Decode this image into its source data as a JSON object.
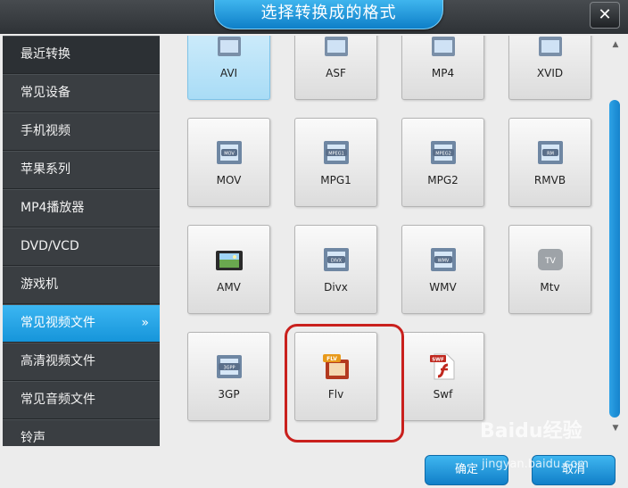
{
  "dialog": {
    "title": "选择转换成的格式",
    "close_label": "✕"
  },
  "sidebar": {
    "items": [
      {
        "label": "最近转换"
      },
      {
        "label": "常见设备"
      },
      {
        "label": "手机视频"
      },
      {
        "label": "苹果系列"
      },
      {
        "label": "MP4播放器"
      },
      {
        "label": "DVD/VCD"
      },
      {
        "label": "游戏机"
      },
      {
        "label": "常见视频文件",
        "active": true,
        "chevron": "»"
      },
      {
        "label": "高清视频文件"
      },
      {
        "label": "常见音频文件"
      },
      {
        "label": "铃声"
      }
    ]
  },
  "formats": [
    {
      "label": "AVI",
      "icon": "avi-film-icon",
      "selected": true
    },
    {
      "label": "ASF",
      "icon": "asf-film-icon"
    },
    {
      "label": "MP4",
      "icon": "mp4-film-icon"
    },
    {
      "label": "XVID",
      "icon": "xvid-film-icon"
    },
    {
      "label": "MOV",
      "icon": "mov-film-icon",
      "badge": "MOV"
    },
    {
      "label": "MPG1",
      "icon": "mpg1-film-icon",
      "badge": "MPEG1"
    },
    {
      "label": "MPG2",
      "icon": "mpg2-film-icon",
      "badge": "MPEG2"
    },
    {
      "label": "RMVB",
      "icon": "rmvb-film-icon",
      "badge": "RM"
    },
    {
      "label": "AMV",
      "icon": "amv-video-icon"
    },
    {
      "label": "Divx",
      "icon": "divx-film-icon",
      "badge": "DIVX"
    },
    {
      "label": "WMV",
      "icon": "wmv-film-icon",
      "badge": "WMV"
    },
    {
      "label": "Mtv",
      "icon": "apple-tv-icon"
    },
    {
      "label": "3GP",
      "icon": "3gp-film-icon",
      "badge": "3GPP"
    },
    {
      "label": "Flv",
      "icon": "flv-film-icon",
      "badge": "FLV",
      "highlighted": true
    },
    {
      "label": "Swf",
      "icon": "swf-flash-icon",
      "badge": "SWF"
    }
  ],
  "footer": {
    "ok_label": "确定",
    "cancel_label": "取消"
  },
  "watermark": {
    "text": "Baidu经验",
    "sub": "jingyan.baidu.com"
  },
  "colors": {
    "accent": "#1a97dc",
    "highlight_ring": "#c9201d"
  }
}
